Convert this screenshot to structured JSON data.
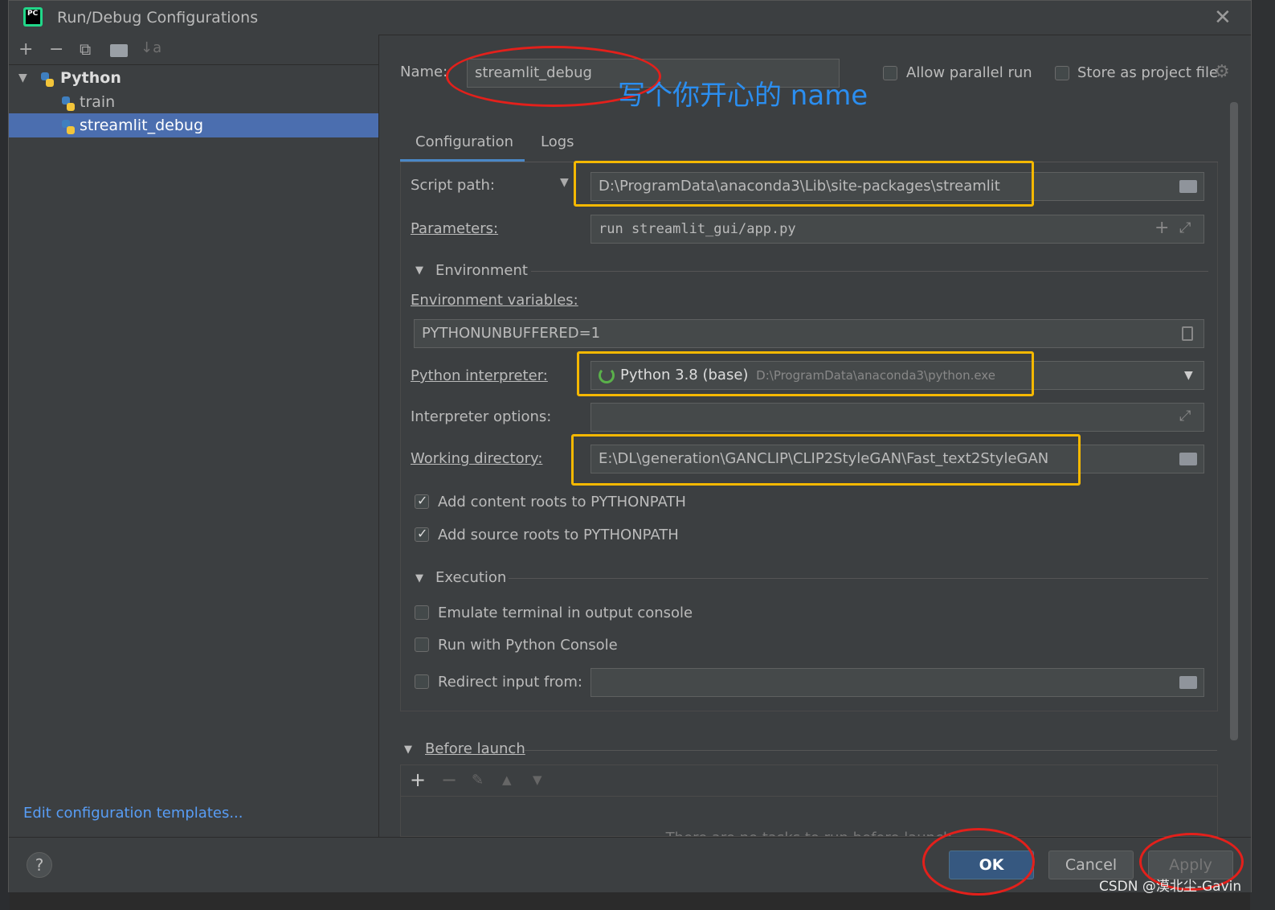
{
  "window": {
    "title": "Run/Debug Configurations"
  },
  "toolbar": {
    "add": "+",
    "remove": "−",
    "copy": "⧉",
    "folder": "▸",
    "sort": "↓a"
  },
  "tree": {
    "group_label": "Python",
    "items": [
      {
        "label": "train",
        "selected": false
      },
      {
        "label": "streamlit_debug",
        "selected": true
      }
    ]
  },
  "edit_templates_link": "Edit configuration templates...",
  "name_row": {
    "label": "Name:",
    "value": "streamlit_debug",
    "allow_parallel_label": "Allow parallel run",
    "allow_parallel_checked": false,
    "store_project_label": "Store as project file",
    "store_project_checked": false
  },
  "annotation": "写个你开心的 name",
  "tabs": [
    {
      "label": "Configuration",
      "active": true
    },
    {
      "label": "Logs",
      "active": false
    }
  ],
  "config": {
    "script_path_label": "Script path:",
    "script_path_value": "D:\\ProgramData\\anaconda3\\Lib\\site-packages\\streamlit",
    "parameters_label": "Parameters:",
    "parameters_value": "run streamlit_gui/app.py",
    "environment_section": "Environment",
    "env_vars_label": "Environment variables:",
    "env_vars_value": "PYTHONUNBUFFERED=1",
    "interpreter_label": "Python interpreter:",
    "interpreter_name": "Python 3.8 (base)",
    "interpreter_path": "D:\\ProgramData\\anaconda3\\python.exe",
    "interp_options_label": "Interpreter options:",
    "interp_options_value": "",
    "working_dir_label": "Working directory:",
    "working_dir_value": "E:\\DL\\generation\\GANCLIP\\CLIP2StyleGAN\\Fast_text2StyleGAN",
    "add_content_roots_label": "Add content roots to PYTHONPATH",
    "add_content_roots_checked": true,
    "add_source_roots_label": "Add source roots to PYTHONPATH",
    "add_source_roots_checked": true,
    "execution_section": "Execution",
    "emulate_terminal_label": "Emulate terminal in output console",
    "emulate_terminal_checked": false,
    "run_console_label": "Run with Python Console",
    "run_console_checked": false,
    "redirect_input_label": "Redirect input from:",
    "redirect_input_checked": false,
    "redirect_input_value": ""
  },
  "before_launch": {
    "label": "Before launch",
    "empty_text": "There are no tasks to run before launch"
  },
  "buttons": {
    "help": "?",
    "ok": "OK",
    "cancel": "Cancel",
    "apply": "Apply"
  },
  "watermark": "CSDN @漠北尘-Gavin",
  "colors": {
    "dialog_bg": "#3c3f41",
    "selection": "#4b6eaf",
    "highlight_yellow": "#f5b800",
    "highlight_red": "#e3201b",
    "annotation_blue": "#2b8ef0",
    "link": "#589df6"
  }
}
